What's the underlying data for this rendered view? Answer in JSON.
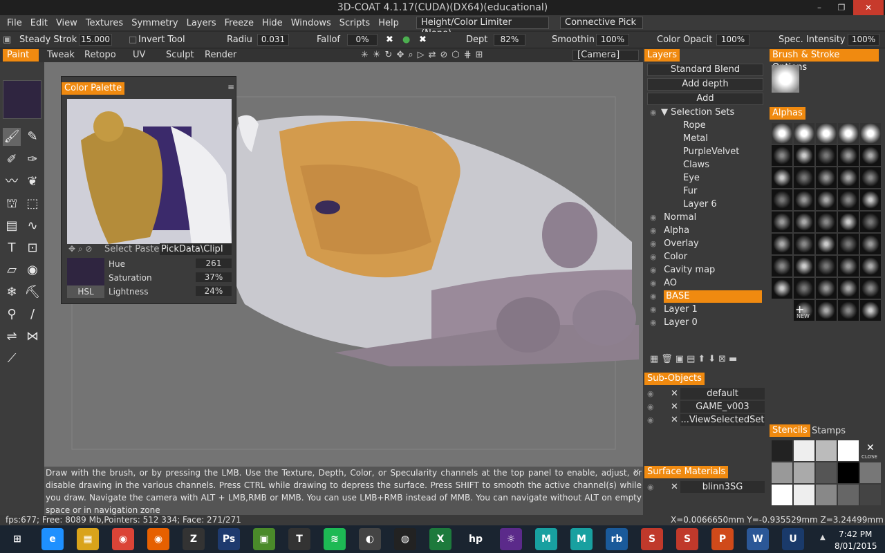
{
  "window": {
    "title": "3D-COAT 4.1.17(CUDA)(DX64)(educational)",
    "controls": [
      "–",
      "❐",
      "✕"
    ]
  },
  "menu": [
    "File",
    "Edit",
    "View",
    "Textures",
    "Symmetry",
    "Layers",
    "Freeze",
    "Hide",
    "Windows",
    "Scripts",
    "Help"
  ],
  "menu_dropdowns": {
    "limiter": "Height/Color Limiter (None)",
    "pick": "Connective Pick"
  },
  "toolbar": {
    "steady_label": "Steady Strok",
    "steady_value": "15.000",
    "invert_label": "Invert Tool",
    "radius_label": "Radiu",
    "radius_value": "0.031",
    "falloff_label": "Fallof",
    "falloff_value": "0%",
    "depth_label": "Dept",
    "depth_value": "82%",
    "smooth_label": "Smoothin",
    "smooth_value": "100%",
    "color_label": "Color Opacit",
    "color_value": "100%",
    "spec_label": "Spec. Intensity",
    "spec_value": "100%"
  },
  "modes": [
    "Paint",
    "Tweak",
    "Retopo",
    "UV",
    "Sculpt",
    "Render"
  ],
  "camera": "[Camera]",
  "palette": {
    "title": "Color Palette",
    "select_label": "Select Paste",
    "pick_label": "PickData\\ClipI",
    "hue_label": "Hue",
    "hue_value": "261",
    "sat_label": "Saturation",
    "sat_value": "37%",
    "light_label": "Lightness",
    "light_value": "24%",
    "mode": "HSL",
    "swatch": "#2f2540"
  },
  "layers": {
    "title": "Layers",
    "blend": "Standard Blend",
    "depth": "Add depth",
    "add": "Add",
    "selection_sets": "Selection Sets",
    "sets": [
      "Rope",
      "Metal",
      "PurpleVelvet",
      "Claws",
      "Eye",
      "Fur",
      "Layer 6"
    ],
    "items": [
      "Normal",
      "Alpha",
      "Overlay",
      "Color",
      "Cavity map",
      "AO",
      "BASE",
      "Layer 1",
      "Layer 0"
    ],
    "selected": "BASE"
  },
  "subobjects": {
    "title": "Sub-Objects",
    "items": [
      "default",
      "GAME_v003",
      "...ViewSelectedSet"
    ]
  },
  "materials": {
    "title": "Surface Materials",
    "items": [
      "blinn3SG"
    ]
  },
  "brush": {
    "title": "Brush & Stroke Options",
    "alphas_title": "Alphas",
    "new_label": "NEW",
    "stencils_tab": "Stencils",
    "stamps_tab": "Stamps",
    "close_label": "CLOSE"
  },
  "hint": "Draw with the brush, or by pressing the LMB. Use the Texture, Depth, Color, or Specularity channels at the top panel to enable, adjust, or disable drawing in the various channels. Press CTRL while drawing to depress the surface. Press SHIFT to smooth the active channel(s) while you draw. Navigate the camera with ALT + LMB,RMB or MMB. You can use LMB+RMB instead of MMB. You can navigate without ALT on empty space or in navigation zone",
  "status": {
    "left": "fps:677; Free: 8089 Mb,Pointers: 512 334; Face: 271/271",
    "right": "X=0.0066650mm  Y=-0.935529mm  Z=3.24499mm"
  },
  "taskbar": {
    "time": "7:42 PM",
    "date": "8/01/2015",
    "apps": [
      "start",
      "ie",
      "explorer",
      "chrome",
      "firefox",
      "zbrush",
      "photoshop",
      "3dcoat",
      "topogun",
      "spotify",
      "substance",
      "marmoset",
      "excel",
      "hp",
      "unknown",
      "mudbox",
      "maya",
      "rb",
      "substance-designer",
      "s2",
      "powerpoint",
      "word",
      "unreal"
    ]
  },
  "colors": {
    "accent": "#f08a10",
    "viewport": "#747474",
    "panel": "#3a3a3a"
  }
}
